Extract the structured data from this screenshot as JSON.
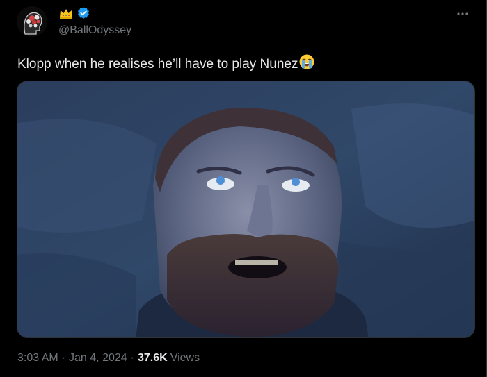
{
  "colors": {
    "background": "#000000",
    "text_primary": "#e7e9ea",
    "text_secondary": "#71767b",
    "verified_badge": "#1d9bf0",
    "crown": "#f5c518"
  },
  "author": {
    "handle": "@BallOdyssey",
    "avatar_icon": "brain-head-avatar",
    "name_icons": [
      "crown-icon",
      "verified-badge-icon"
    ]
  },
  "tweet": {
    "text": "Klopp when he realises he’ll have to play Nunez",
    "emoji": "loudly-crying-face-emoji",
    "media_description_icon": "photo"
  },
  "meta": {
    "time": "3:03 AM",
    "separator": "·",
    "date": "Jan 4, 2024",
    "views_count": "37.6K",
    "views_label": "Views"
  },
  "actions": {
    "more_icon": "more-options-icon"
  }
}
